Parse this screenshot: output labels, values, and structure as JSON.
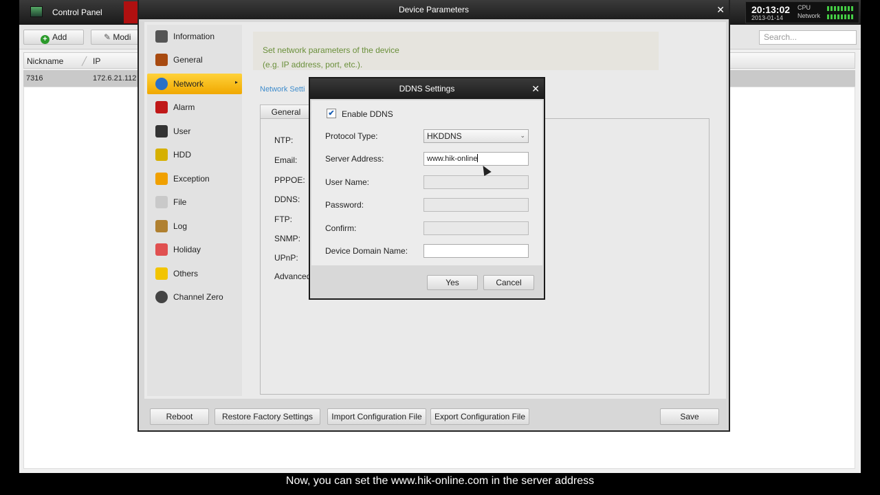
{
  "app": {
    "title": "Control Panel",
    "clock_time": "20:13:02",
    "clock_date": "2013-01-14",
    "cpu_label": "CPU",
    "network_label": "Network",
    "add_label": "Add",
    "modify_label": "Modi",
    "search_placeholder": "Search...",
    "columns": [
      "Nickname",
      "IP"
    ],
    "row": {
      "nickname": "7316",
      "ip": "172.6.21.112"
    }
  },
  "device_params": {
    "title": "Device Parameters",
    "sidebar": [
      {
        "label": "Information",
        "icon": "information-icon",
        "color": "#555555"
      },
      {
        "label": "General",
        "icon": "general-icon",
        "color": "#a84a10"
      },
      {
        "label": "Network",
        "icon": "network-globe-icon",
        "color": "#2a70c8"
      },
      {
        "label": "Alarm",
        "icon": "alarm-light-icon",
        "color": "#c01818"
      },
      {
        "label": "User",
        "icon": "user-icon",
        "color": "#333333"
      },
      {
        "label": "HDD",
        "icon": "hdd-radiation-icon",
        "color": "#d6b000"
      },
      {
        "label": "Exception",
        "icon": "warning-icon",
        "color": "#f0a000"
      },
      {
        "label": "File",
        "icon": "file-icon",
        "color": "#c9c9c9"
      },
      {
        "label": "Log",
        "icon": "log-icon",
        "color": "#b08030"
      },
      {
        "label": "Holiday",
        "icon": "holiday-calendar-icon",
        "color": "#e05050"
      },
      {
        "label": "Others",
        "icon": "star-icon",
        "color": "#f2c400"
      },
      {
        "label": "Channel Zero",
        "icon": "camera-icon",
        "color": "#444444"
      }
    ],
    "active_item": "Network",
    "description_line1": "Set network parameters of the device",
    "description_line2": "(e.g. IP address, port, etc.).",
    "network_settings_link": "Network Setti",
    "general_tab": "General",
    "panel_labels": [
      "NTP:",
      "Email:",
      "PPPOE:",
      "DDNS:",
      "FTP:",
      "SNMP:",
      "UPnP:",
      "Advanced"
    ],
    "footer": {
      "reboot": "Reboot",
      "restore": "Restore Factory Settings",
      "import": "Import Configuration File",
      "export": "Export Configuration File",
      "save": "Save"
    }
  },
  "ddns_dialog": {
    "title": "DDNS Settings",
    "enable_label": "Enable DDNS",
    "enabled": true,
    "protocol_label": "Protocol Type:",
    "protocol_value": "HKDDNS",
    "server_label": "Server Address:",
    "server_value": "www.hik-online",
    "username_label": "User Name:",
    "password_label": "Password:",
    "confirm_label": "Confirm:",
    "domain_label": "Device Domain Name:",
    "yes": "Yes",
    "cancel": "Cancel"
  },
  "subtitle": "Now, you can set the www.hik-online.com in the server address"
}
